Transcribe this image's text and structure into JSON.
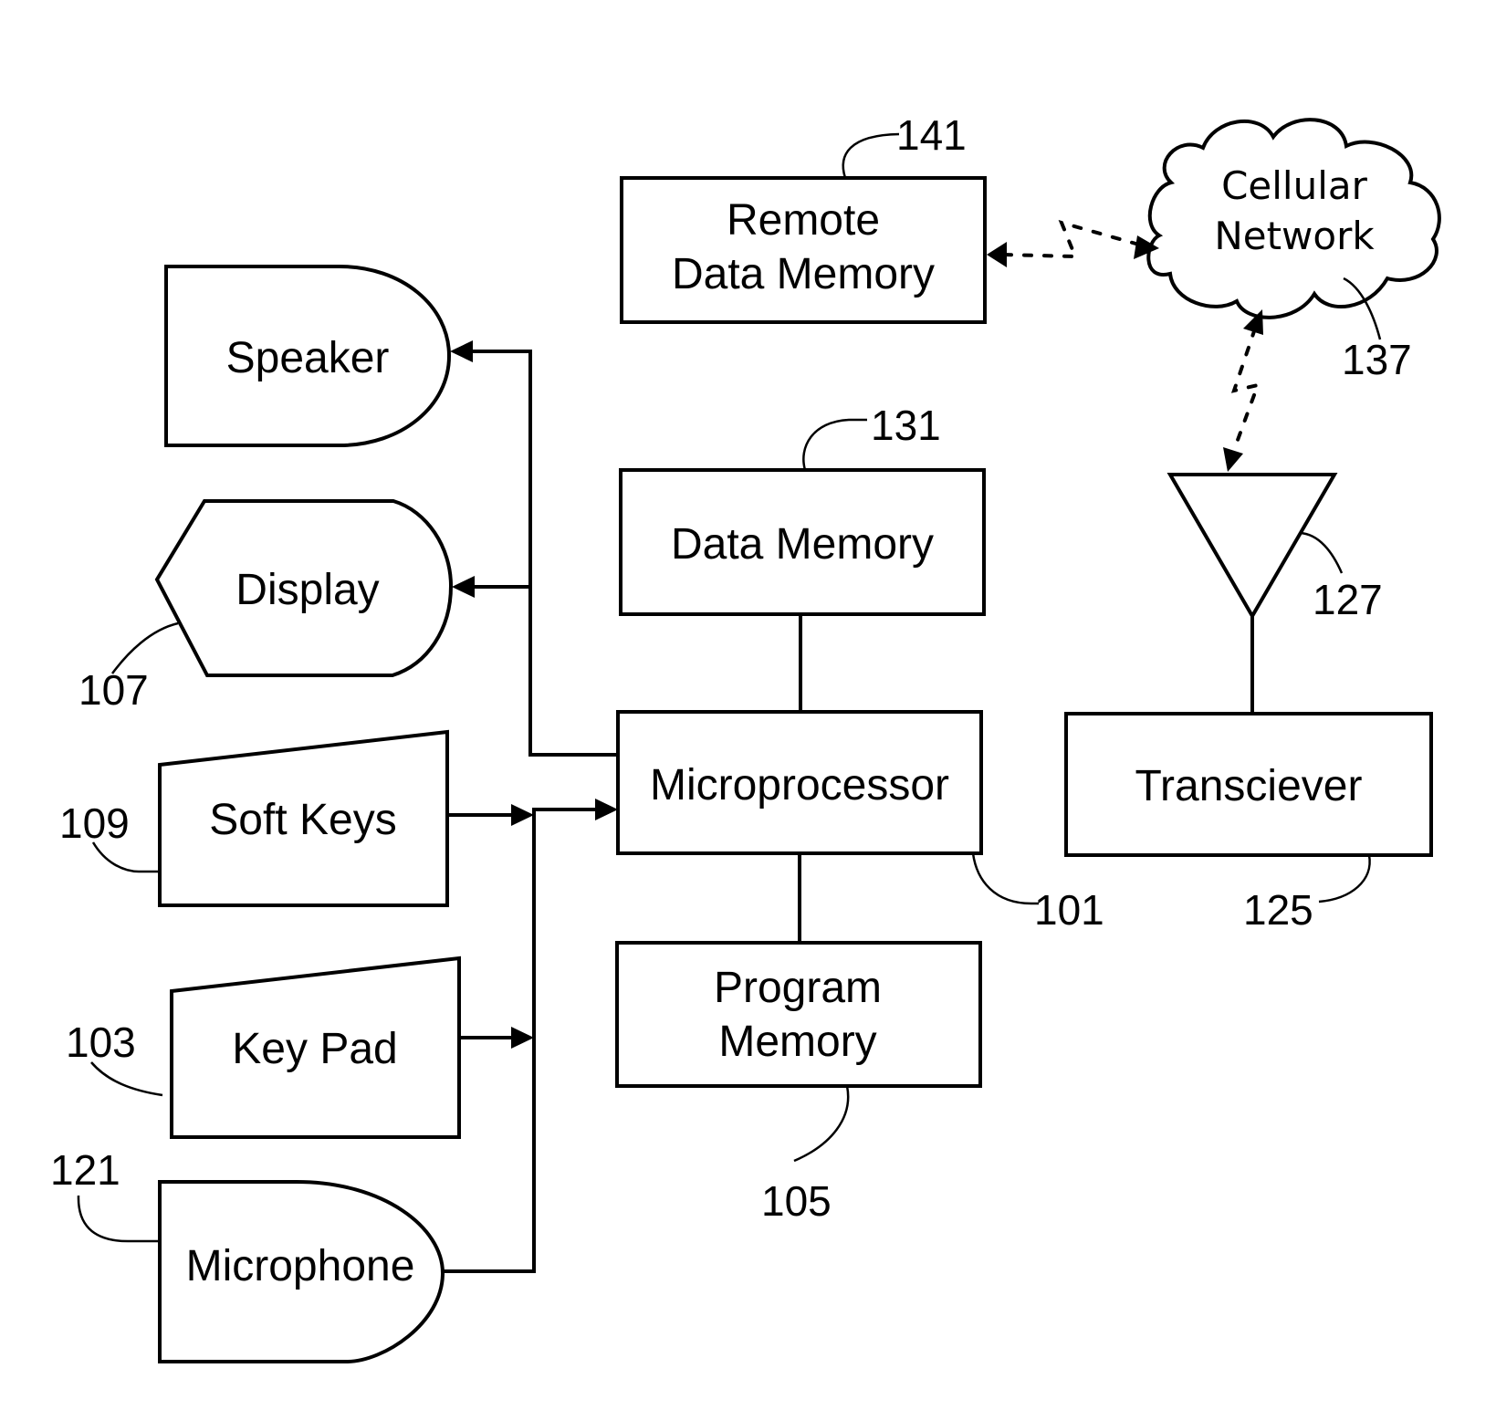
{
  "figure": {
    "blocks": {
      "remote_data_memory": {
        "line1": "Remote",
        "line2": "Data Memory",
        "ref": "141"
      },
      "cellular_network": {
        "line1": "Cellular",
        "line2": "Network",
        "ref": "137"
      },
      "speaker": {
        "label": "Speaker"
      },
      "display": {
        "label": "Display",
        "ref": "107"
      },
      "data_memory": {
        "label": "Data Memory",
        "ref": "131"
      },
      "antenna": {
        "ref": "127"
      },
      "soft_keys": {
        "label": "Soft Keys",
        "ref": "109"
      },
      "microprocessor": {
        "label": "Microprocessor",
        "ref": "101"
      },
      "transceiver": {
        "label": "Transciever",
        "ref": "125"
      },
      "key_pad": {
        "label": "Key Pad",
        "ref": "103"
      },
      "program_memory": {
        "line1": "Program",
        "line2": "Memory",
        "ref": "105"
      },
      "microphone": {
        "label": "Microphone",
        "ref": "121"
      }
    },
    "connections": [
      {
        "from": "microprocessor",
        "to": "speaker",
        "type": "arrow"
      },
      {
        "from": "microprocessor",
        "to": "display",
        "type": "arrow"
      },
      {
        "from": "soft_keys",
        "to": "microprocessor",
        "type": "arrow"
      },
      {
        "from": "key_pad",
        "to": "microprocessor",
        "type": "arrow"
      },
      {
        "from": "microphone",
        "to": "microprocessor",
        "type": "line"
      },
      {
        "from": "data_memory",
        "to": "microprocessor",
        "type": "line"
      },
      {
        "from": "microprocessor",
        "to": "program_memory",
        "type": "line"
      },
      {
        "from": "antenna",
        "to": "transceiver",
        "type": "line"
      },
      {
        "from": "remote_data_memory",
        "to": "cellular_network",
        "type": "wireless-bidirectional"
      },
      {
        "from": "cellular_network",
        "to": "antenna",
        "type": "wireless-bidirectional"
      }
    ]
  }
}
